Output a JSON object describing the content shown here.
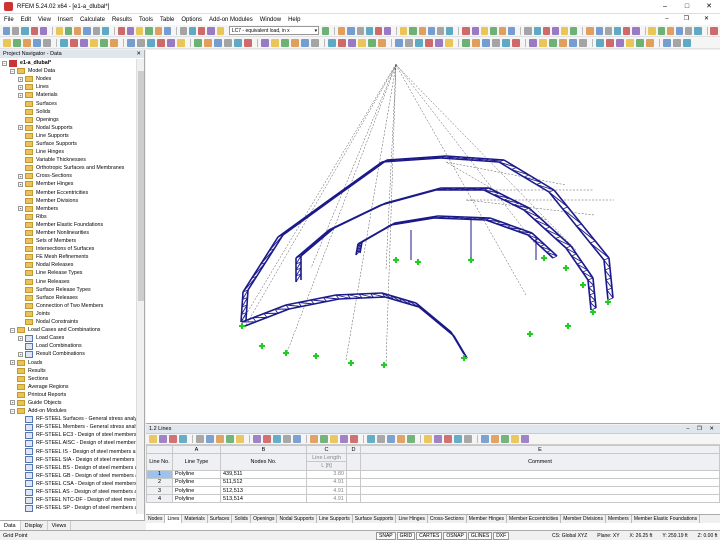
{
  "window": {
    "title": "RFEM 5.24.02 x64 - [e1-a_dlubal*]"
  },
  "menu": [
    "File",
    "Edit",
    "View",
    "Insert",
    "Calculate",
    "Results",
    "Tools",
    "Table",
    "Options",
    "Add-on Modules",
    "Window",
    "Help"
  ],
  "toolbar": {
    "load_case": "LC7 - equivalent load, in x"
  },
  "navigator": {
    "title": "Project Navigator - Data",
    "items": [
      {
        "label": "e1-a_dlubal*",
        "level": 0,
        "icon": "root",
        "exp": "-"
      },
      {
        "label": "Model Data",
        "level": 1,
        "icon": "folder",
        "exp": "-"
      },
      {
        "label": "Nodes",
        "level": 2,
        "icon": "folder",
        "exp": "+"
      },
      {
        "label": "Lines",
        "level": 2,
        "icon": "folder",
        "exp": "+"
      },
      {
        "label": "Materials",
        "level": 2,
        "icon": "folder",
        "exp": "+"
      },
      {
        "label": "Surfaces",
        "level": 2,
        "icon": "folder",
        "exp": ""
      },
      {
        "label": "Solids",
        "level": 2,
        "icon": "folder",
        "exp": ""
      },
      {
        "label": "Openings",
        "level": 2,
        "icon": "folder",
        "exp": ""
      },
      {
        "label": "Nodal Supports",
        "level": 2,
        "icon": "folder",
        "exp": "+"
      },
      {
        "label": "Line Supports",
        "level": 2,
        "icon": "folder",
        "exp": ""
      },
      {
        "label": "Surface Supports",
        "level": 2,
        "icon": "folder",
        "exp": ""
      },
      {
        "label": "Line Hinges",
        "level": 2,
        "icon": "folder",
        "exp": ""
      },
      {
        "label": "Variable Thicknesses",
        "level": 2,
        "icon": "folder",
        "exp": ""
      },
      {
        "label": "Orthotropic Surfaces and Membranes",
        "level": 2,
        "icon": "folder",
        "exp": ""
      },
      {
        "label": "Cross-Sections",
        "level": 2,
        "icon": "folder",
        "exp": "+"
      },
      {
        "label": "Member Hinges",
        "level": 2,
        "icon": "folder",
        "exp": "+"
      },
      {
        "label": "Member Eccentricities",
        "level": 2,
        "icon": "folder",
        "exp": ""
      },
      {
        "label": "Member Divisions",
        "level": 2,
        "icon": "folder",
        "exp": ""
      },
      {
        "label": "Members",
        "level": 2,
        "icon": "folder",
        "exp": "+"
      },
      {
        "label": "Ribs",
        "level": 2,
        "icon": "folder",
        "exp": ""
      },
      {
        "label": "Member Elastic Foundations",
        "level": 2,
        "icon": "folder",
        "exp": ""
      },
      {
        "label": "Member Nonlinearities",
        "level": 2,
        "icon": "folder",
        "exp": ""
      },
      {
        "label": "Sets of Members",
        "level": 2,
        "icon": "folder",
        "exp": ""
      },
      {
        "label": "Intersections of Surfaces",
        "level": 2,
        "icon": "folder",
        "exp": ""
      },
      {
        "label": "FE Mesh Refinements",
        "level": 2,
        "icon": "folder",
        "exp": ""
      },
      {
        "label": "Nodal Releases",
        "level": 2,
        "icon": "folder",
        "exp": ""
      },
      {
        "label": "Line Release Types",
        "level": 2,
        "icon": "folder",
        "exp": ""
      },
      {
        "label": "Line Releases",
        "level": 2,
        "icon": "folder",
        "exp": ""
      },
      {
        "label": "Surface Release Types",
        "level": 2,
        "icon": "folder",
        "exp": ""
      },
      {
        "label": "Surface Releases",
        "level": 2,
        "icon": "folder",
        "exp": ""
      },
      {
        "label": "Connection of Two Members",
        "level": 2,
        "icon": "folder",
        "exp": ""
      },
      {
        "label": "Joints",
        "level": 2,
        "icon": "folder",
        "exp": ""
      },
      {
        "label": "Nodal Constraints",
        "level": 2,
        "icon": "folder",
        "exp": ""
      },
      {
        "label": "Load Cases and Combinations",
        "level": 1,
        "icon": "folder",
        "exp": "-"
      },
      {
        "label": "Load Cases",
        "level": 2,
        "icon": "doc",
        "exp": "+"
      },
      {
        "label": "Load Combinations",
        "level": 2,
        "icon": "doc",
        "exp": ""
      },
      {
        "label": "Result Combinations",
        "level": 2,
        "icon": "doc",
        "exp": "+"
      },
      {
        "label": "Loads",
        "level": 1,
        "icon": "folder",
        "exp": "+"
      },
      {
        "label": "Results",
        "level": 1,
        "icon": "folder",
        "exp": ""
      },
      {
        "label": "Sections",
        "level": 1,
        "icon": "folder",
        "exp": ""
      },
      {
        "label": "Average Regions",
        "level": 1,
        "icon": "folder",
        "exp": ""
      },
      {
        "label": "Printout Reports",
        "level": 1,
        "icon": "folder",
        "exp": ""
      },
      {
        "label": "Guide Objects",
        "level": 1,
        "icon": "folder",
        "exp": "+"
      },
      {
        "label": "Add-on Modules",
        "level": 1,
        "icon": "folder",
        "exp": "-"
      },
      {
        "label": "RF-STEEL Surfaces - General stress analysis",
        "level": 2,
        "icon": "doc",
        "exp": ""
      },
      {
        "label": "RF-STEEL Members - General stress analysis",
        "level": 2,
        "icon": "doc",
        "exp": ""
      },
      {
        "label": "RF-STEEL EC3 - Design of steel members",
        "level": 2,
        "icon": "doc",
        "exp": ""
      },
      {
        "label": "RF-STEEL AISC - Design of steel members",
        "level": 2,
        "icon": "doc",
        "exp": ""
      },
      {
        "label": "RF-STEEL IS - Design of steel members a",
        "level": 2,
        "icon": "doc",
        "exp": ""
      },
      {
        "label": "RF-STEEL SIA - Design of steel members",
        "level": 2,
        "icon": "doc",
        "exp": ""
      },
      {
        "label": "RF-STEEL BS - Design of steel members a",
        "level": 2,
        "icon": "doc",
        "exp": ""
      },
      {
        "label": "RF-STEEL GB - Design of steel members a",
        "level": 2,
        "icon": "doc",
        "exp": ""
      },
      {
        "label": "RF-STEEL CSA - Design of steel members",
        "level": 2,
        "icon": "doc",
        "exp": ""
      },
      {
        "label": "RF-STEEL AS - Design of steel members a",
        "level": 2,
        "icon": "doc",
        "exp": ""
      },
      {
        "label": "RF-STEEL NTC-DF - Design of steel member",
        "level": 2,
        "icon": "doc",
        "exp": ""
      },
      {
        "label": "RF-STEEL SP - Design of steel members a",
        "level": 2,
        "icon": "doc",
        "exp": ""
      }
    ],
    "tabs": [
      "Data",
      "Display",
      "Views"
    ]
  },
  "table_panel": {
    "title": "1.2 Lines",
    "col_letters": [
      "A",
      "B",
      "C",
      "D",
      "E"
    ],
    "headers": {
      "no": "Line No.",
      "a": "Line Type",
      "b": "Nodes No.",
      "c_top": "Line Length",
      "c_bottom": "L [ft]",
      "d": "",
      "e": "Comment"
    },
    "rows": [
      {
        "no": "1",
        "type": "Polyline",
        "nodes": "439,511",
        "length": "3.80",
        "comment": ""
      },
      {
        "no": "2",
        "type": "Polyline",
        "nodes": "511,512",
        "length": "4.91",
        "comment": ""
      },
      {
        "no": "3",
        "type": "Polyline",
        "nodes": "512,513",
        "length": "4.91",
        "comment": ""
      },
      {
        "no": "4",
        "type": "Polyline",
        "nodes": "513,514",
        "length": "4.91",
        "comment": ""
      }
    ],
    "sheet_tabs": [
      "Nodes",
      "Lines",
      "Materials",
      "Surfaces",
      "Solids",
      "Openings",
      "Nodal Supports",
      "Line Supports",
      "Surface Supports",
      "Line Hinges",
      "Cross-Sections",
      "Member Hinges",
      "Member Eccentricities",
      "Member Divisions",
      "Members",
      "Member Elastic Foundations"
    ],
    "active_tab": "Lines"
  },
  "statusbar": {
    "left": "Grid Point",
    "buttons": [
      "SNAP",
      "GRID",
      "CARTES",
      "OSNAP",
      "GLINES",
      "DXF"
    ],
    "cs": "CS: Global XYZ",
    "plane": "Plane: XY",
    "x": "X: 26.25 ft",
    "y": "Y: 259.19 ft",
    "z": "Z: 0.00 ft"
  },
  "colors": {
    "truss": "#1c1a8a",
    "support": "#22cc22",
    "cable": "#555555",
    "selection": "#9cc3ec"
  }
}
